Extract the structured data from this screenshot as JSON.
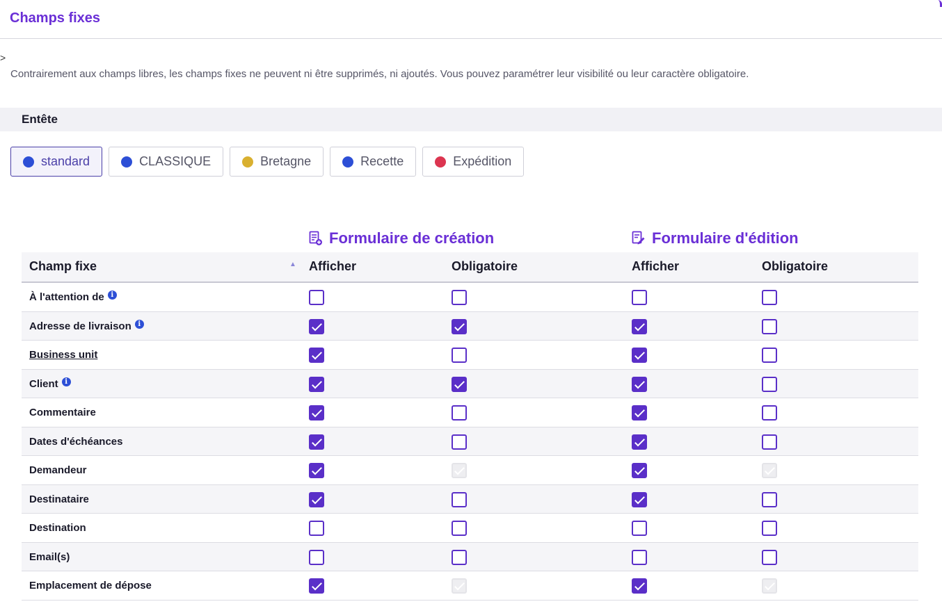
{
  "page": {
    "title": "Champs fixes",
    "stray_char": ">",
    "description": "Contrairement aux champs libres, les champs fixes ne peuvent ni être supprimés, ni ajoutés. Vous pouvez paramétrer leur visibilité ou leur caractère obligatoire."
  },
  "section": {
    "title": "Entête"
  },
  "types": [
    {
      "label": "standard",
      "color": "#2d4fd6",
      "active": true
    },
    {
      "label": "CLASSIQUE",
      "color": "#2d4fd6",
      "active": false
    },
    {
      "label": "Bretagne",
      "color": "#d9b030",
      "active": false
    },
    {
      "label": "Recette",
      "color": "#2d4fd6",
      "active": false
    },
    {
      "label": "Expédition",
      "color": "#dc3550",
      "active": false
    }
  ],
  "forms": {
    "creation_title": "Formulaire de création",
    "edition_title": "Formulaire d'édition"
  },
  "columns": {
    "field": "Champ fixe",
    "create_show": "Afficher",
    "create_required": "Obligatoire",
    "edit_show": "Afficher",
    "edit_required": "Obligatoire"
  },
  "info_glyph": "i",
  "rows": [
    {
      "name": "À l'attention de",
      "info": true,
      "underline": false,
      "values": [
        "unchecked",
        "unchecked",
        "unchecked",
        "unchecked"
      ]
    },
    {
      "name": "Adresse de livraison",
      "info": true,
      "underline": false,
      "values": [
        "checked",
        "checked",
        "checked",
        "unchecked"
      ]
    },
    {
      "name": "Business unit",
      "info": false,
      "underline": true,
      "values": [
        "checked",
        "unchecked",
        "checked",
        "unchecked"
      ]
    },
    {
      "name": "Client",
      "info": true,
      "underline": false,
      "values": [
        "checked",
        "checked",
        "checked",
        "unchecked"
      ]
    },
    {
      "name": "Commentaire",
      "info": false,
      "underline": false,
      "values": [
        "checked",
        "unchecked",
        "checked",
        "unchecked"
      ]
    },
    {
      "name": "Dates d'échéances",
      "info": false,
      "underline": false,
      "values": [
        "checked",
        "unchecked",
        "checked",
        "unchecked"
      ]
    },
    {
      "name": "Demandeur",
      "info": false,
      "underline": false,
      "values": [
        "checked",
        "disabled",
        "checked",
        "disabled"
      ]
    },
    {
      "name": "Destinataire",
      "info": false,
      "underline": false,
      "values": [
        "checked",
        "unchecked",
        "checked",
        "unchecked"
      ]
    },
    {
      "name": "Destination",
      "info": false,
      "underline": false,
      "values": [
        "unchecked",
        "unchecked",
        "unchecked",
        "unchecked"
      ]
    },
    {
      "name": "Email(s)",
      "info": false,
      "underline": false,
      "values": [
        "unchecked",
        "unchecked",
        "unchecked",
        "unchecked"
      ]
    },
    {
      "name": "Emplacement de dépose",
      "info": false,
      "underline": false,
      "values": [
        "checked",
        "disabled",
        "checked",
        "disabled"
      ]
    }
  ],
  "colors": {
    "accent": "#6a2fd6",
    "checkbox": "#5a2fc8",
    "info": "#2d4fd6"
  }
}
